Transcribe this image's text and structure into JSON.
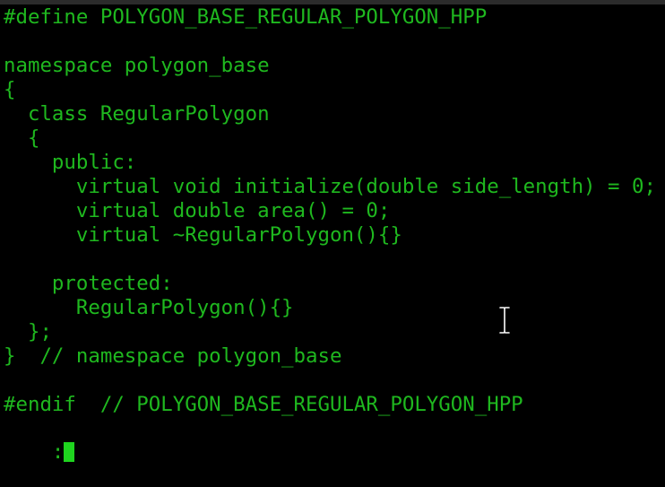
{
  "window": {
    "colors": {
      "background": "#000000",
      "text": "#1fb81f",
      "cursor": "#1fd41f",
      "pointer": "#ffffff"
    }
  },
  "editor": {
    "lines": [
      "#define POLYGON_BASE_REGULAR_POLYGON_HPP",
      "",
      "namespace polygon_base",
      "{",
      "  class RegularPolygon",
      "  {",
      "    public:",
      "      virtual void initialize(double side_length) = 0;",
      "      virtual double area() = 0;",
      "      virtual ~RegularPolygon(){}",
      "",
      "    protected:",
      "      RegularPolygon(){}",
      "  };",
      "}  // namespace polygon_base",
      "",
      "#endif  // POLYGON_BASE_REGULAR_POLYGON_HPP"
    ],
    "command_prompt": ":",
    "pointer_icon": "text-ibeam-icon",
    "cursor_icon": "block-cursor-icon"
  }
}
